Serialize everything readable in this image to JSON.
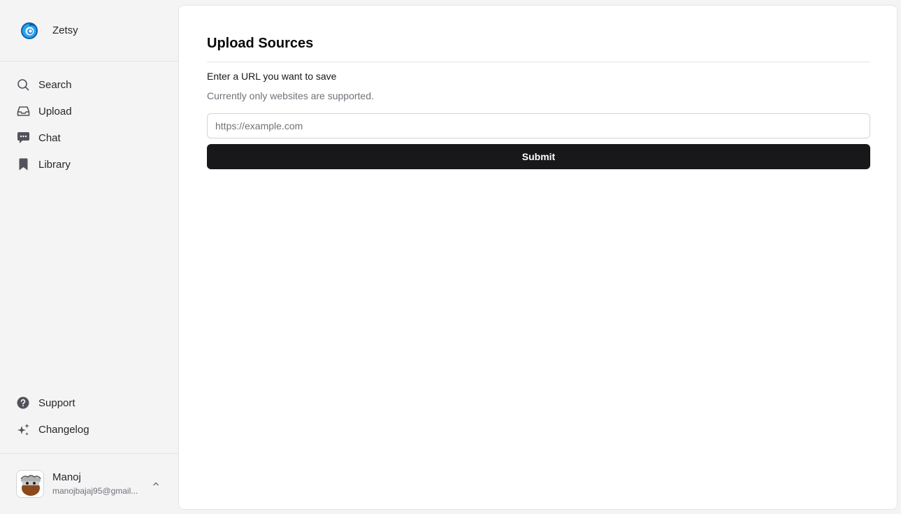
{
  "app": {
    "name": "Zetsy"
  },
  "sidebar": {
    "nav": [
      {
        "label": "Search",
        "icon": "search-icon"
      },
      {
        "label": "Upload",
        "icon": "inbox-icon"
      },
      {
        "label": "Chat",
        "icon": "chat-bubble-icon"
      },
      {
        "label": "Library",
        "icon": "bookmark-icon"
      }
    ],
    "bottom_nav": [
      {
        "label": "Support",
        "icon": "help-circle-icon"
      },
      {
        "label": "Changelog",
        "icon": "sparkles-icon"
      }
    ],
    "user": {
      "name": "Manoj",
      "email": "manojbajaj95@gmail...",
      "chevron_icon": "chevron-up-icon"
    }
  },
  "main": {
    "title": "Upload Sources",
    "field_label": "Enter a URL you want to save",
    "field_help": "Currently only websites are supported.",
    "url_placeholder": "https://example.com",
    "url_value": "",
    "submit_label": "Submit"
  },
  "colors": {
    "sidebar_bg": "#f4f4f5",
    "primary_button": "#18181b",
    "logo_accent": "#1e90e8"
  }
}
